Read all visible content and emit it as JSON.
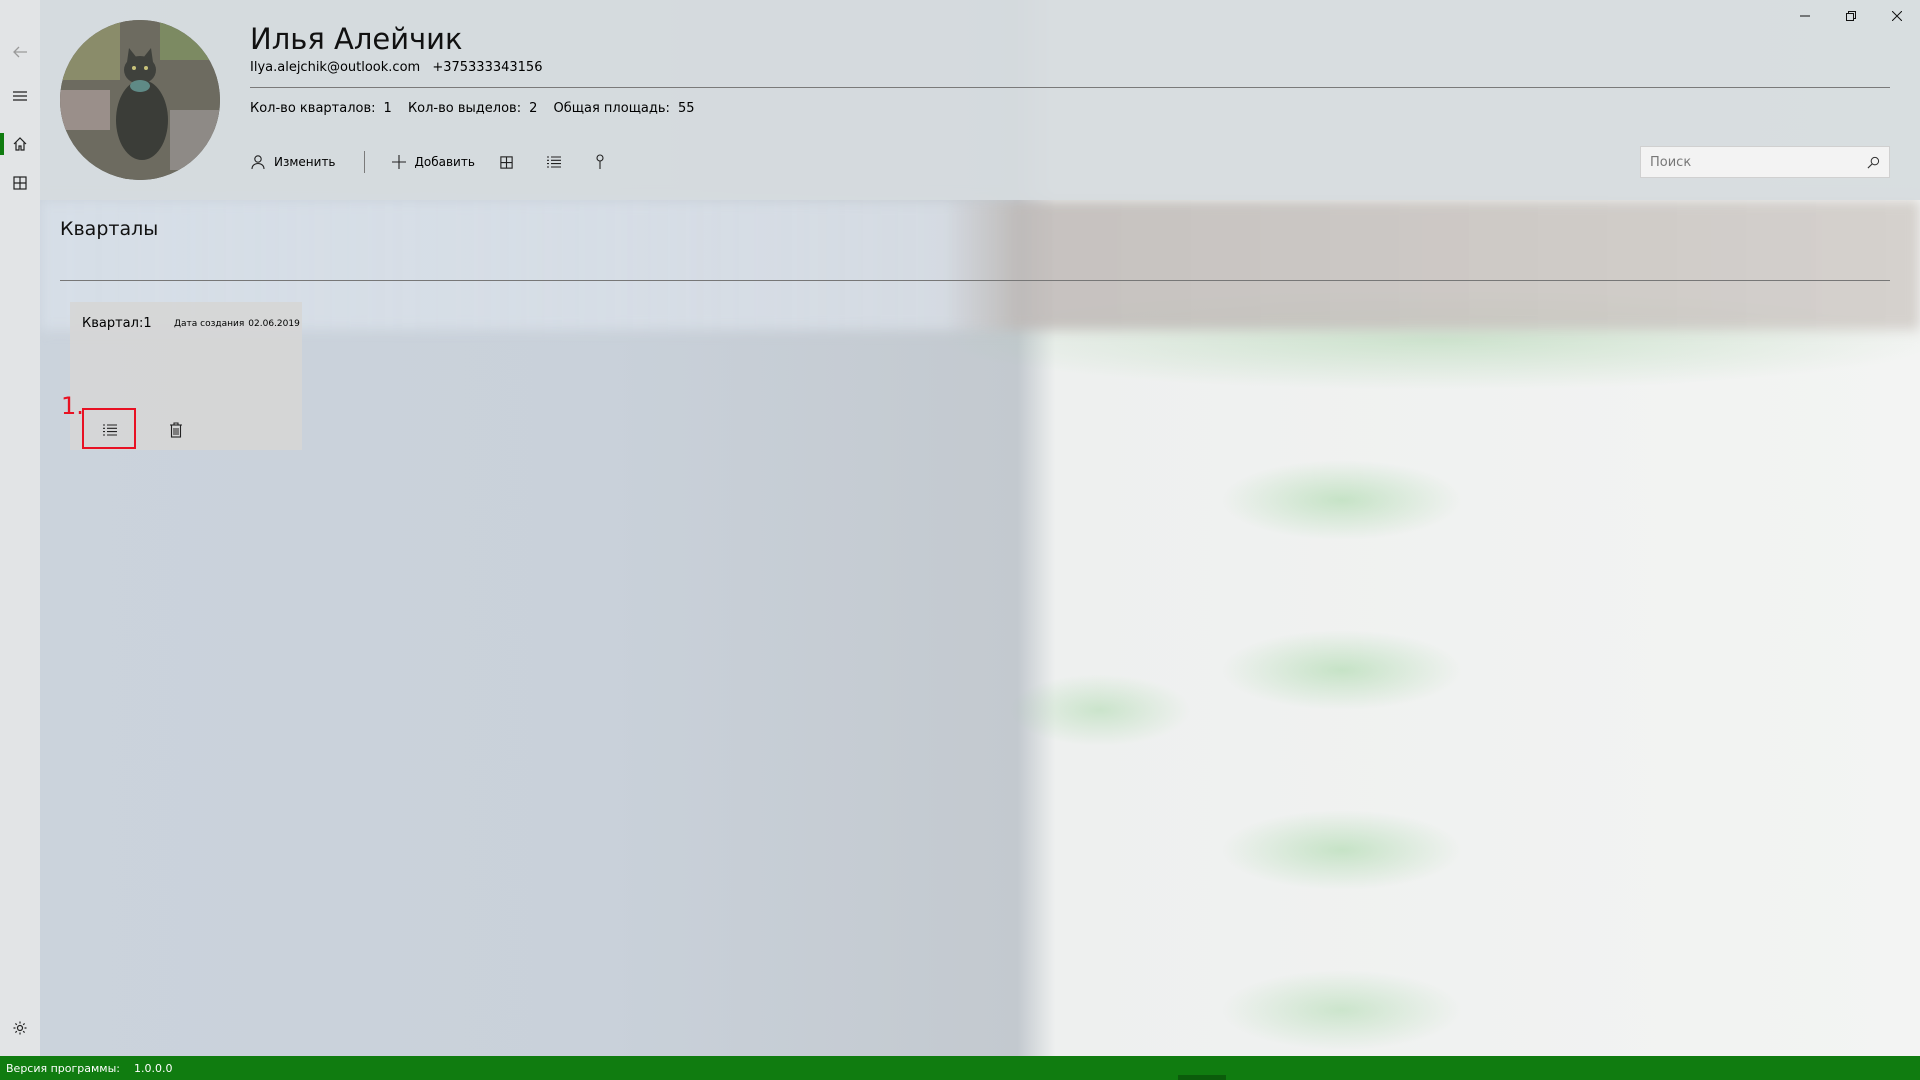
{
  "user": {
    "name": "Илья Алейчик",
    "email": "Ilya.alejchik@outlook.com",
    "phone": "+375333343156"
  },
  "stats": {
    "blocks_label": "Кол-во кварталов:",
    "blocks_value": "1",
    "plots_label": "Кол-во выделов:",
    "plots_value": "2",
    "area_label": "Общая площадь:",
    "area_value": "55"
  },
  "toolbar": {
    "edit_label": "Изменить",
    "add_label": "Добавить",
    "icons": [
      "grid-icon",
      "list-icon",
      "pin-icon"
    ]
  },
  "search": {
    "placeholder": "Поиск"
  },
  "section": {
    "title": "Кварталы"
  },
  "cards": [
    {
      "title": "Квартал:1",
      "date_label": "Дата создания",
      "date_value": "02.06.2019"
    }
  ],
  "annotation": {
    "marker": "1."
  },
  "statusbar": {
    "version_label": "Версия программы:",
    "version_value": "1.0.0.0"
  },
  "colors": {
    "accent": "#107c10",
    "highlight": "#e81123"
  }
}
